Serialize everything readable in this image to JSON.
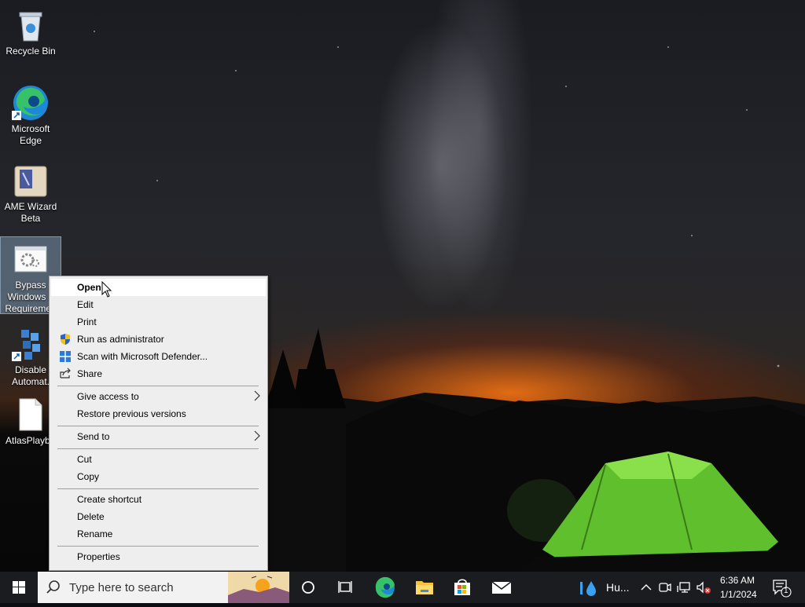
{
  "desktop": {
    "icons": [
      {
        "label": "Recycle Bin",
        "icon": "recycle-bin-icon"
      },
      {
        "label": "Microsoft Edge",
        "icon": "edge-icon"
      },
      {
        "label": "AME Wizard Beta",
        "icon": "ame-wizard-icon"
      },
      {
        "label": "Bypass Windows 1 Requiremen",
        "icon": "settings-script-icon",
        "selected": true
      },
      {
        "label": "Disable Automat.",
        "icon": "registry-icon"
      },
      {
        "label": "AtlasPlayb",
        "icon": "blank-file-icon"
      }
    ]
  },
  "context_menu": {
    "items": [
      {
        "label": "Open",
        "bold": true,
        "hover": true
      },
      {
        "label": "Edit"
      },
      {
        "label": "Print"
      },
      {
        "label": "Run as administrator",
        "icon": "uac-shield-icon"
      },
      {
        "label": "Scan with Microsoft Defender...",
        "icon": "defender-icon"
      },
      {
        "label": "Share",
        "icon": "share-icon"
      },
      {
        "label": "Give access to",
        "submenu": true
      },
      {
        "label": "Restore previous versions"
      },
      {
        "label": "Send to",
        "submenu": true
      },
      {
        "label": "Cut"
      },
      {
        "label": "Copy"
      },
      {
        "label": "Create shortcut"
      },
      {
        "label": "Delete"
      },
      {
        "label": "Rename"
      },
      {
        "label": "Properties"
      }
    ]
  },
  "taskbar": {
    "search_placeholder": "Type here to search",
    "pinned": [
      "task-view-icon",
      "edge-icon",
      "file-explorer-icon",
      "microsoft-store-icon",
      "mail-icon"
    ],
    "weather_text": "Hu...",
    "time": "6:36 AM",
    "date": "1/1/2024",
    "notification_count": "1"
  },
  "colors": {
    "taskbar": "#1b1c20",
    "menu_bg": "#eeeeee",
    "menu_hover": "#ffffff",
    "selection": "#8caac8"
  }
}
